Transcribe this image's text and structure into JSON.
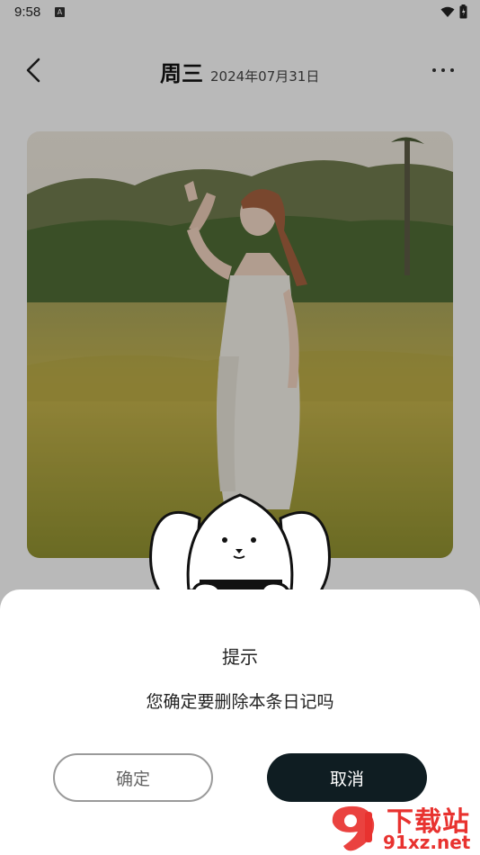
{
  "status_bar": {
    "time": "9:58",
    "notification_icon": "A"
  },
  "header": {
    "weekday": "周三",
    "date": "2024年07月31日"
  },
  "dialog": {
    "title": "提示",
    "message": "您确定要删除本条日记吗",
    "confirm_label": "确定",
    "cancel_label": "取消"
  },
  "watermark": {
    "text_top": "下载站",
    "text_bottom": "91xz.net"
  },
  "icons": [
    "back-arrow-icon",
    "more-dots-icon",
    "wifi-icon",
    "battery-icon"
  ],
  "colors": {
    "cancel_button_bg": "#0f1d22",
    "watermark_red": "#e8322f",
    "sheet_bg": "#ffffff"
  }
}
